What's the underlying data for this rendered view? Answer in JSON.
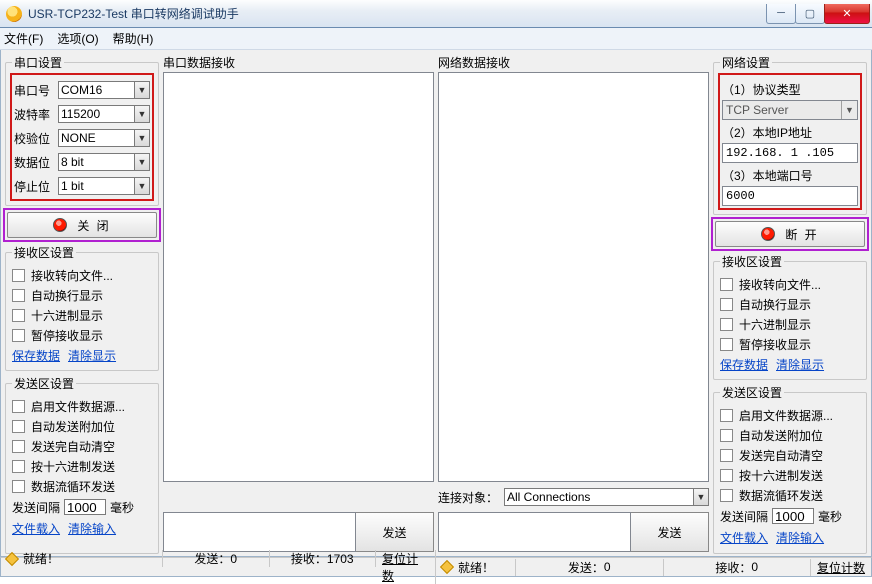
{
  "window": {
    "title": "USR-TCP232-Test 串口转网络调试助手"
  },
  "menu": {
    "file": "文件(F)",
    "options": "选项(O)",
    "help": "帮助(H)"
  },
  "serial": {
    "legend": "串口设置",
    "rows": {
      "port": {
        "label": "串口号",
        "value": "COM16"
      },
      "baud": {
        "label": "波特率",
        "value": "115200"
      },
      "parity": {
        "label": "校验位",
        "value": "NONE"
      },
      "databits": {
        "label": "数据位",
        "value": "8 bit"
      },
      "stopbits": {
        "label": "停止位",
        "value": "1 bit"
      }
    },
    "button": "关 闭"
  },
  "net": {
    "legend": "网络设置",
    "proto_label": "（1）协议类型",
    "proto_value": "TCP Server",
    "ip_label": "（2）本地IP地址",
    "ip_value": "192.168. 1 .105",
    "port_label": "（3）本地端口号",
    "port_value": "6000",
    "button": "断 开"
  },
  "recv_opts": {
    "legend": "接收区设置",
    "items": [
      "接收转向文件...",
      "自动换行显示",
      "十六进制显示",
      "暂停接收显示"
    ],
    "save_link": "保存数据",
    "clear_link": "清除显示"
  },
  "send_opts": {
    "legend": "发送区设置",
    "items": [
      "启用文件数据源...",
      "自动发送附加位",
      "发送完自动清空",
      "按十六进制发送",
      "数据流循环发送"
    ],
    "interval_label": "发送间隔",
    "interval_value": "1000",
    "interval_suffix": "毫秒",
    "load_link": "文件载入",
    "clear_link": "清除输入"
  },
  "center": {
    "serial_recv_title": "串口数据接收",
    "net_recv_title": "网络数据接收",
    "conn_label": "连接对象：",
    "conn_value": "All Connections",
    "send_btn": "发送"
  },
  "status": {
    "ready": "就绪！",
    "send_prefix": "发送：",
    "recv_prefix": "接收：",
    "reset": "复位计数",
    "left": {
      "send": "0",
      "recv": "1703"
    },
    "right": {
      "send": "0",
      "recv": "0"
    }
  }
}
